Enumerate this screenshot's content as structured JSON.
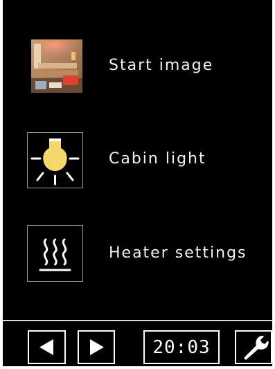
{
  "menu": {
    "items": [
      {
        "label": "Start image",
        "icon": "sauna-photo-icon"
      },
      {
        "label": "Cabin light",
        "icon": "light-bulb-icon"
      },
      {
        "label": "Heater settings",
        "icon": "heater-icon"
      }
    ]
  },
  "toolbar": {
    "prev_icon": "triangle-left-icon",
    "next_icon": "triangle-right-icon",
    "clock": "20:03",
    "settings_icon": "wrench-icon"
  },
  "colors": {
    "background": "#000000",
    "foreground": "#ffffff",
    "bulb": "#f6d76a"
  }
}
